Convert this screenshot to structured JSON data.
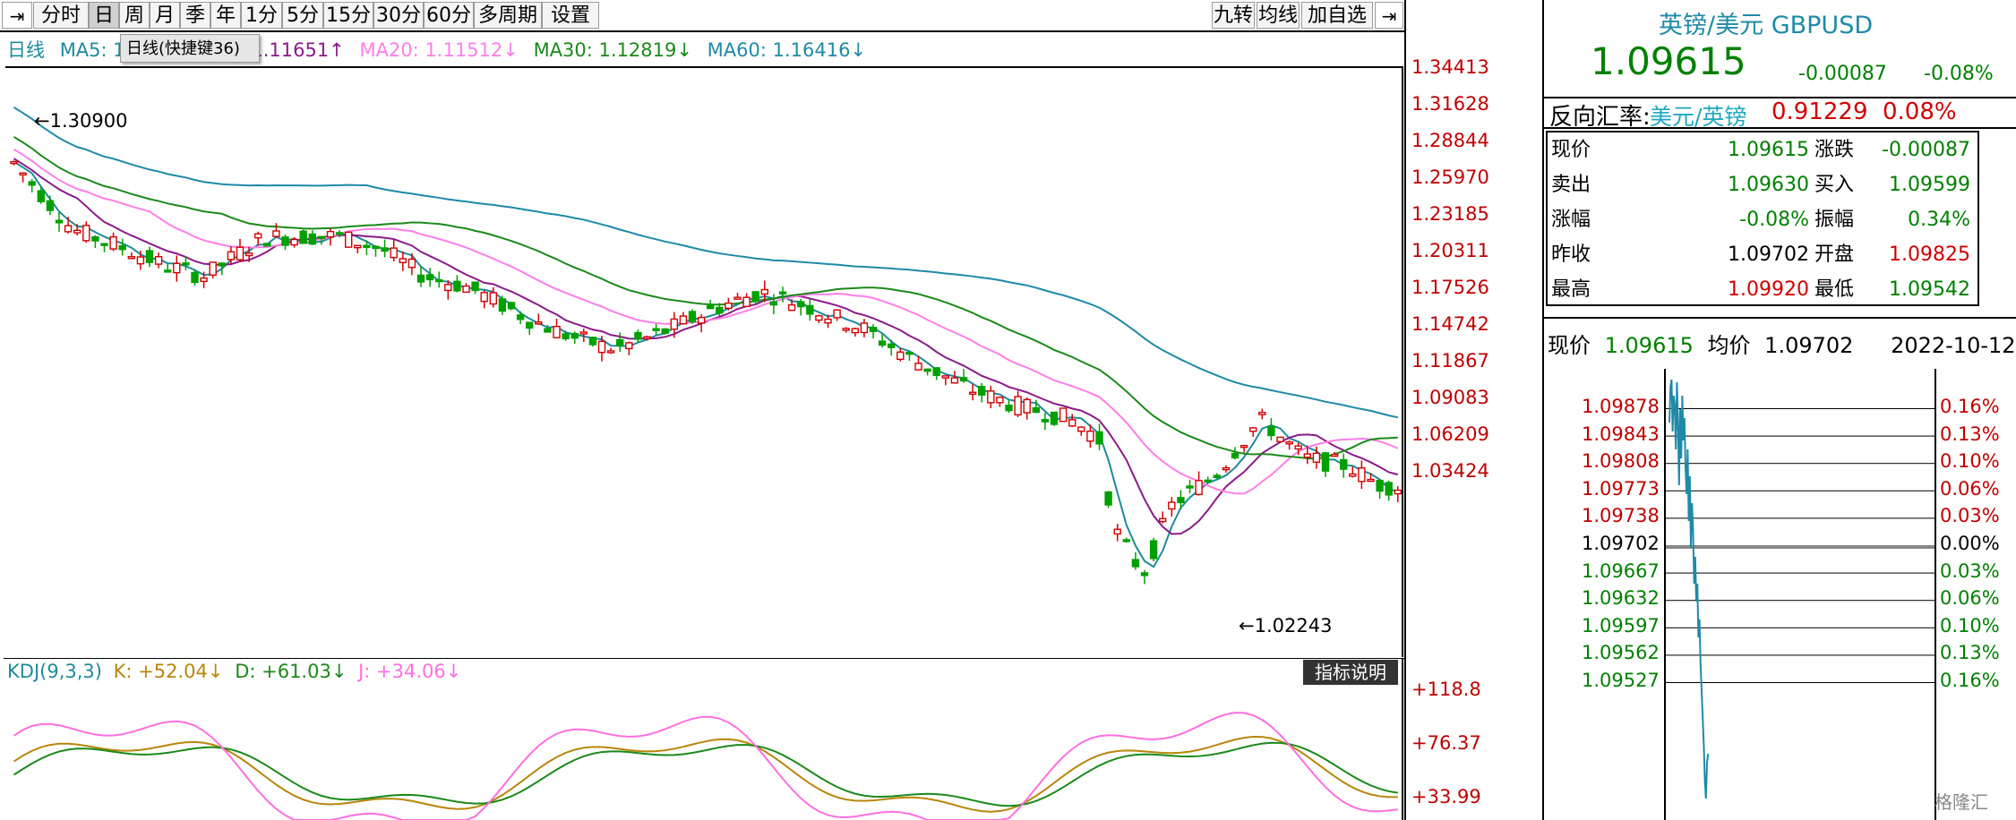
{
  "toolbar": {
    "left_arrow": "⇥",
    "tabs": [
      "分时",
      "日",
      "周",
      "月",
      "季",
      "年",
      "1分",
      "5分",
      "15分",
      "30分",
      "60分",
      "多周期",
      "设置"
    ],
    "active_tab": "日",
    "right_buttons": [
      "九转",
      "均线",
      "加自选"
    ],
    "right_arrow": "⇥"
  },
  "ma_legend": {
    "period_label": "日线",
    "ma5": "MA5: 1",
    "ma10_tail": "1.11651↑",
    "ma20": "MA20: 1.11512↓",
    "ma30": "MA30: 1.12819↓",
    "ma60": "MA60: 1.16416↓",
    "tooltip": "日线(快捷键36)"
  },
  "main_chart": {
    "price_ticks": [
      "1.34413",
      "1.31628",
      "1.28844",
      "1.25970",
      "1.23185",
      "1.20311",
      "1.17526",
      "1.14742",
      "1.11867",
      "1.09083",
      "1.06209",
      "1.03424"
    ],
    "high_mark": "1.30900",
    "low_mark": "1.02243"
  },
  "kdj": {
    "title": "KDJ(9,3,3)",
    "k": "K: +52.04↓",
    "d": "D: +61.03↓",
    "j": "J: +34.06↓",
    "button": "指标说明",
    "ticks": [
      "+118.8",
      "+76.37",
      "+33.99"
    ]
  },
  "instrument": {
    "name": "英镑/美元",
    "code": "GBPUSD",
    "price": "1.09615",
    "change": "-0.00087",
    "change_pct": "-0.08%",
    "reverse_label": "反向汇率:",
    "reverse_pair": "美元/英镑",
    "reverse_price": "0.91229",
    "reverse_pct": "0.08%"
  },
  "quote": {
    "rows": [
      {
        "l1": "现价",
        "v1": "1.09615",
        "l2": "涨跌",
        "v2": "-0.00087"
      },
      {
        "l1": "卖出",
        "v1": "1.09630",
        "l2": "买入",
        "v2": "1.09599"
      },
      {
        "l1": "涨幅",
        "v1": "-0.08%",
        "l2": "振幅",
        "v2": "0.34%"
      },
      {
        "l1": "昨收",
        "v1": "1.09702",
        "l2": "开盘",
        "v2": "1.09825"
      },
      {
        "l1": "最高",
        "v1": "1.09920",
        "l2": "最低",
        "v2": "1.09542"
      }
    ]
  },
  "intraday": {
    "now_label": "现价",
    "now_value": "1.09615",
    "avg_label": "均价",
    "avg_value": "1.09702",
    "date": "2022-10-12",
    "price_ticks": [
      "1.09878",
      "1.09843",
      "1.09808",
      "1.09773",
      "1.09738",
      "1.09702",
      "1.09667",
      "1.09632",
      "1.09597",
      "1.09562",
      "1.09527"
    ],
    "pct_ticks": [
      "0.16%",
      "0.13%",
      "0.10%",
      "0.06%",
      "0.03%",
      "0.00%",
      "0.03%",
      "0.06%",
      "0.10%",
      "0.13%",
      "0.16%"
    ],
    "watermark": "格隆汇"
  },
  "colors": {
    "up": "#d40000",
    "down": "#00a000",
    "ma5": "#1e8a9c",
    "ma10": "#8b1a8b",
    "ma20": "#ff7ee8",
    "ma30": "#1a8a1a",
    "ma60": "#1e8aa8",
    "kdj_k": "#b8860b",
    "kdj_d": "#1a8a1a",
    "kdj_j": "#ff6ee0"
  }
}
